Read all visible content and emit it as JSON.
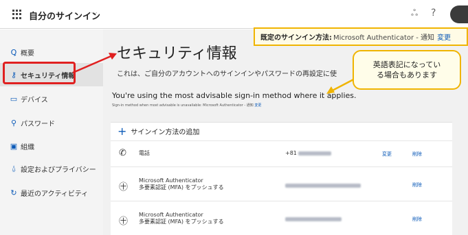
{
  "header": {
    "app_title": "自分のサインイン",
    "chevron": "⌵",
    "org_icon": "ஃ",
    "help": "?"
  },
  "sidebar": {
    "items": [
      {
        "icon": "Ꝗ",
        "label": "概要"
      },
      {
        "icon": "⚷",
        "label": "セキュリティ情報"
      },
      {
        "icon": "▭",
        "label": "デバイス"
      },
      {
        "icon": "⚲",
        "label": "パスワード"
      },
      {
        "icon": "▣",
        "label": "組織"
      },
      {
        "icon": "⍙",
        "label": "設定およびプライバシー"
      },
      {
        "icon": "↻",
        "label": "最近のアクティビティ"
      }
    ]
  },
  "main": {
    "title": "セキュリティ情報",
    "description": "これは、ご自分のアカウントへのサインインやパスワードの再設定に使",
    "advisable": "You're using the most advisable sign-in method where it applies.",
    "advisable_sub": "Sign-in method when most advisable is unavailable: Microsoft Authenticator - 通知",
    "advisable_sub_link": "変更"
  },
  "default_banner": {
    "label": "既定のサインイン方法:",
    "value": "Microsoft Authenticator - 通知",
    "change": "変更"
  },
  "callout": {
    "line1": "英語表記になってい",
    "line2": "る場合もあります"
  },
  "methods": {
    "add_label": "サインイン方法の追加",
    "items": [
      {
        "icon": "✆",
        "name": "電話",
        "sub": "",
        "value_prefix": "+81",
        "change": "変更",
        "delete": "削除"
      },
      {
        "icon": "㊉",
        "name": "Microsoft Authenticator",
        "sub": "多要素認証 (MFA) をプッシュする",
        "value_prefix": "",
        "change": "",
        "delete": "削除"
      },
      {
        "icon": "㊉",
        "name": "Microsoft Authenticator",
        "sub": "多要素認証 (MFA) をプッシュする",
        "value_prefix": "",
        "change": "",
        "delete": "削除"
      }
    ]
  },
  "colors": {
    "accent": "#0b5ab8",
    "highlight_red": "#e02020",
    "callout_border": "#f0b400"
  }
}
